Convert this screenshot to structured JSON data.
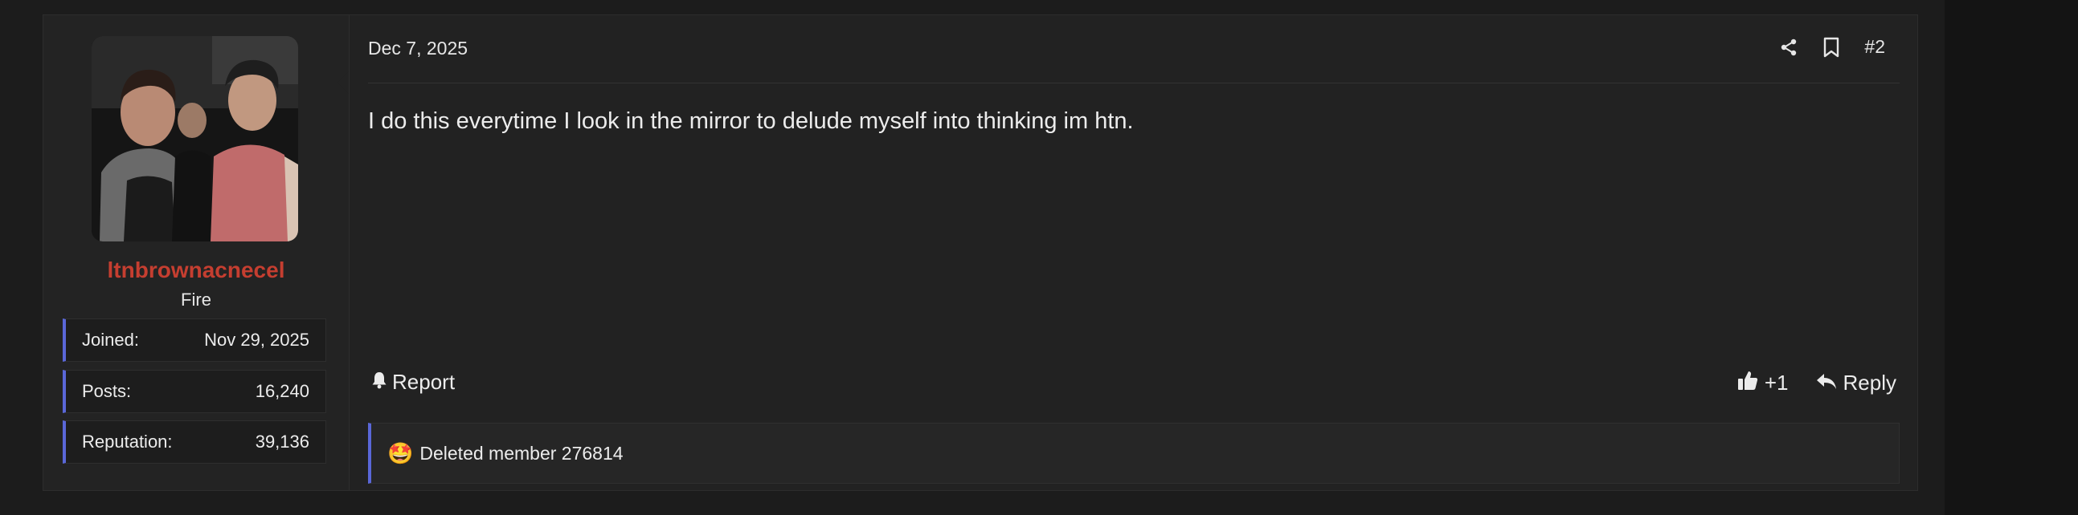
{
  "post": {
    "date": "Dec 7, 2025",
    "number": "#2",
    "body": "I do this everytime I look in the mirror to delude myself into thinking im htn.",
    "report_label": "Report",
    "like_count": "+1",
    "reply_label": "Reply",
    "reactions_text": "Deleted member 276814",
    "reaction_emoji": "🤩"
  },
  "user": {
    "name": "ltnbrownacnecel",
    "title": "Fire",
    "stats": [
      {
        "label": "Joined:",
        "value": "Nov 29, 2025"
      },
      {
        "label": "Posts:",
        "value": "16,240"
      },
      {
        "label": "Reputation:",
        "value": "39,136"
      }
    ]
  },
  "colors": {
    "username": "#c53e30",
    "accent_bar": "#5a67d8",
    "background": "#222222"
  },
  "icons": [
    "share-icon",
    "bookmark-icon",
    "bell-icon",
    "thumbs-up-icon",
    "reply-icon"
  ]
}
